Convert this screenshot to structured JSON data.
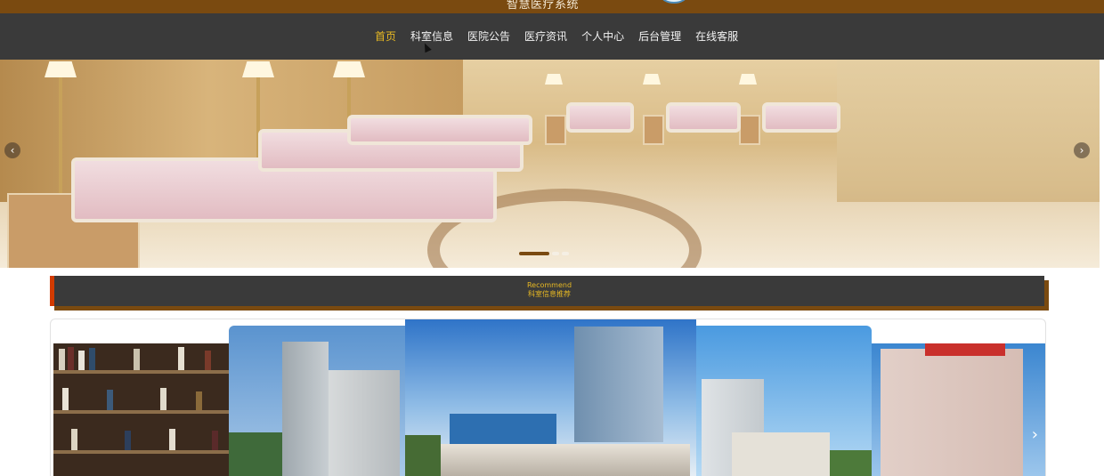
{
  "header": {
    "title": "智慧医疗系统",
    "icon": "hospital-logo"
  },
  "nav": {
    "items": [
      {
        "label": "首页",
        "active": true
      },
      {
        "label": "科室信息",
        "active": false
      },
      {
        "label": "医院公告",
        "active": false
      },
      {
        "label": "医疗资讯",
        "active": false
      },
      {
        "label": "个人中心",
        "active": false
      },
      {
        "label": "后台管理",
        "active": false
      },
      {
        "label": "在线客服",
        "active": false
      }
    ]
  },
  "carousel": {
    "prev_icon": "chevron-left-icon",
    "next_icon": "chevron-right-icon",
    "prev_glyph": "‹",
    "next_glyph": "›",
    "slide_count": 3,
    "active_slide": 1
  },
  "recommend": {
    "title_en": "Recommend",
    "title_cn": "科室信息推荐"
  },
  "gallery": {
    "next_glyph": "›"
  },
  "colors": {
    "brown": "#7a4a10",
    "dark": "#3a3a3a",
    "accent_gold": "#e8b923",
    "accent_red": "#d23b00"
  }
}
